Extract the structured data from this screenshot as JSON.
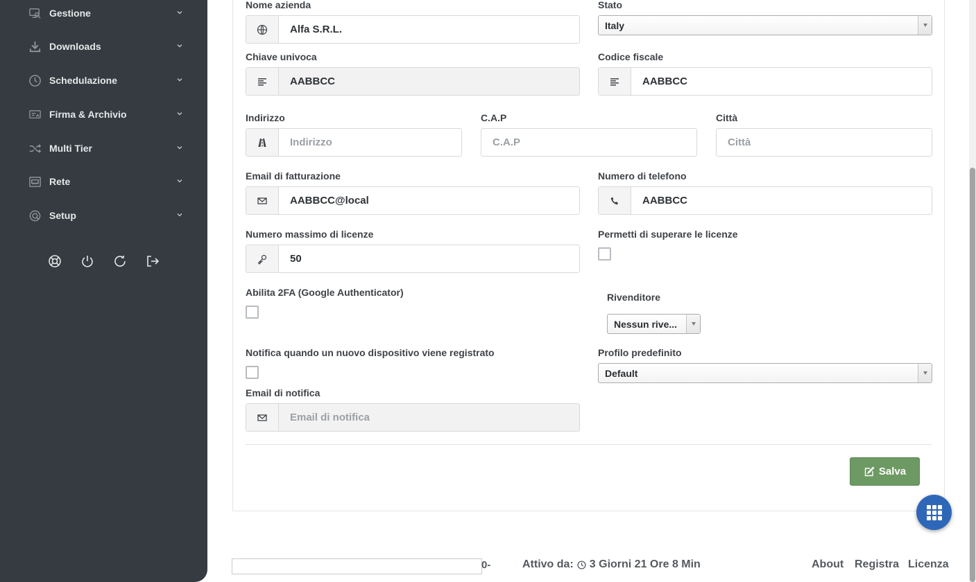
{
  "sidebar": {
    "items": [
      {
        "label": "Gestione",
        "icon": "monitor-search-icon"
      },
      {
        "label": "Downloads",
        "icon": "download-icon"
      },
      {
        "label": "Schedulazione",
        "icon": "clock-icon"
      },
      {
        "label": "Firma & Archivio",
        "icon": "archive-sign-icon"
      },
      {
        "label": "Multi Tier",
        "icon": "shuffle-icon"
      },
      {
        "label": "Rete",
        "icon": "network-icon"
      },
      {
        "label": "Setup",
        "icon": "setup-icon"
      }
    ],
    "tools": [
      "help-icon",
      "power-icon",
      "refresh-icon",
      "logout-icon"
    ]
  },
  "form": {
    "nome_azienda": {
      "label": "Nome azienda",
      "value": "Alfa S.R.L."
    },
    "stato": {
      "label": "Stato",
      "value": "Italy"
    },
    "chiave_univoca": {
      "label": "Chiave univoca",
      "value": "AABBCC"
    },
    "codice_fiscale": {
      "label": "Codice fiscale",
      "value": "AABBCC"
    },
    "indirizzo": {
      "label": "Indirizzo",
      "placeholder": "Indirizzo"
    },
    "cap": {
      "label": "C.A.P",
      "placeholder": "C.A.P"
    },
    "citta": {
      "label": "Città",
      "placeholder": "Città"
    },
    "email_fatturazione": {
      "label": "Email di fatturazione",
      "value": "AABBCC@local"
    },
    "numero_telefono": {
      "label": "Numero di telefono",
      "value": "AABBCC"
    },
    "numero_licenze": {
      "label": "Numero massimo di licenze",
      "value": "50"
    },
    "superare_licenze": {
      "label": "Permetti di superare le licenze",
      "checked": false
    },
    "abilita_2fa": {
      "label": "Abilita 2FA (Google Authenticator)",
      "checked": false
    },
    "rivenditore": {
      "label": "Rivenditore",
      "value": "Nessun rive..."
    },
    "notifica_dispositivo": {
      "label": "Notifica quando un nuovo dispositivo viene registrato",
      "checked": false
    },
    "profilo_predefinito": {
      "label": "Profilo predefinito",
      "value": "Default"
    },
    "email_notifica": {
      "label": "Email di notifica",
      "placeholder": "Email di notifica"
    },
    "save_label": "Salva"
  },
  "footer": {
    "dash": "0-",
    "active_label": "Attivo da:",
    "active_value": "3 Giorni 21 Ore 8 Min",
    "links": [
      "About",
      "Registra",
      "Licenza"
    ]
  },
  "colors": {
    "sidebar_bg": "#353b40",
    "save_button": "#6d9a63",
    "fab": "#2f67b8"
  }
}
